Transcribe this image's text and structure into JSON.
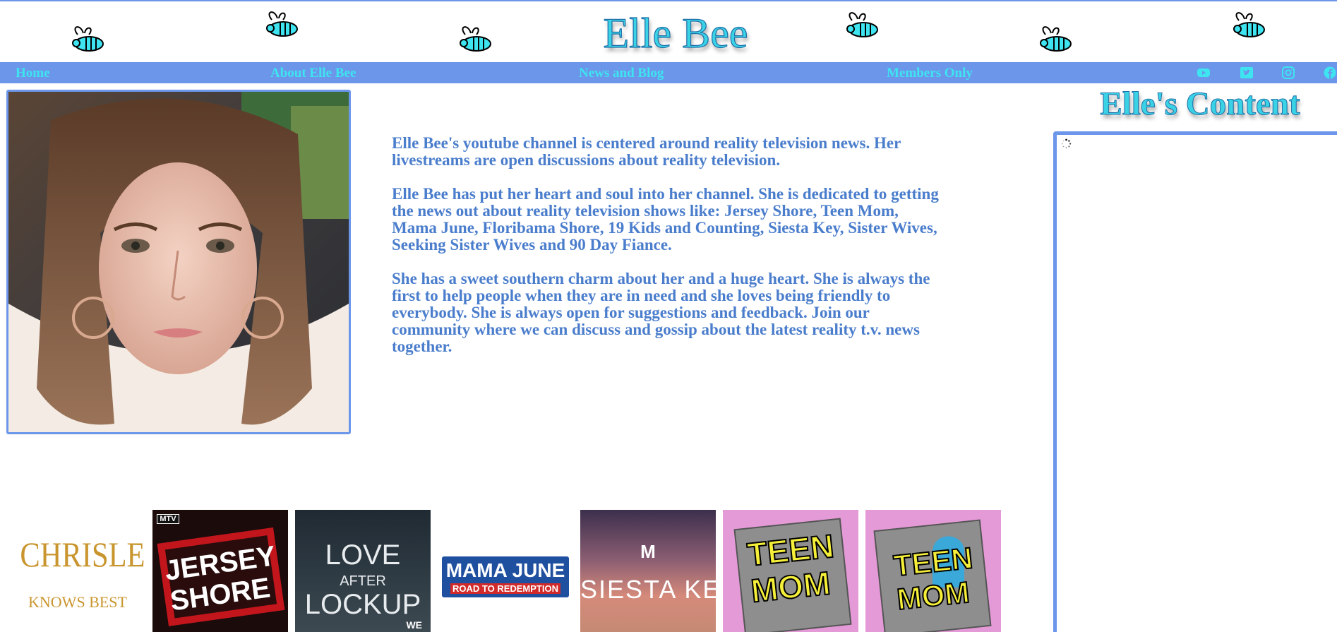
{
  "site": {
    "title": "Elle Bee",
    "theme_colors": {
      "accent": "#6b96ea",
      "title": "#3ad3e6",
      "nav_text": "#3ee4f0",
      "body_text": "#4a7dcc"
    }
  },
  "nav": {
    "items": [
      {
        "label": "Home"
      },
      {
        "label": "About Elle Bee"
      },
      {
        "label": "News and Blog"
      },
      {
        "label": "Members Only"
      }
    ],
    "social_icons": [
      "youtube-icon",
      "twitter-icon",
      "instagram-icon",
      "facebook-icon"
    ]
  },
  "bio": {
    "paragraphs": [
      "Elle Bee's youtube channel is centered around reality television news. Her livestreams are open discussions about reality television.",
      "Elle Bee has put her heart and soul into her channel. She is dedicated to getting the news out about reality television shows like: Jersey Shore, Teen Mom, Mama June, Floribama Shore, 19 Kids and Counting, Siesta Key, Sister Wives, Seeking Sister Wives and 90 Day Fiance.",
      "She has a sweet southern charm about her and a huge heart. She is always the first to help people when they are in need and she loves being friendly to everybody. She is always open for suggestions and feedback. Join our community where we can discuss and gossip about the latest reality t.v. news together."
    ]
  },
  "sidebar": {
    "title": "Elle's Content"
  },
  "shows": [
    {
      "line1": "CHRISLEY",
      "line2": "KNOWS BEST"
    },
    {
      "badge": "MTV",
      "line1": "JERSEY",
      "line2": "SHORE"
    },
    {
      "line1": "LOVE",
      "line2": "AFTER",
      "line3": "LOCKUP",
      "badge": "WE"
    },
    {
      "line1": "MAMA JUNE",
      "line2": "ROAD TO REDEMPTION"
    },
    {
      "badge": "M",
      "line1": "SIESTA KEY"
    },
    {
      "line1": "TEEN",
      "line2": "MOM"
    },
    {
      "line1": "TEEN",
      "line2": "MOM"
    }
  ]
}
